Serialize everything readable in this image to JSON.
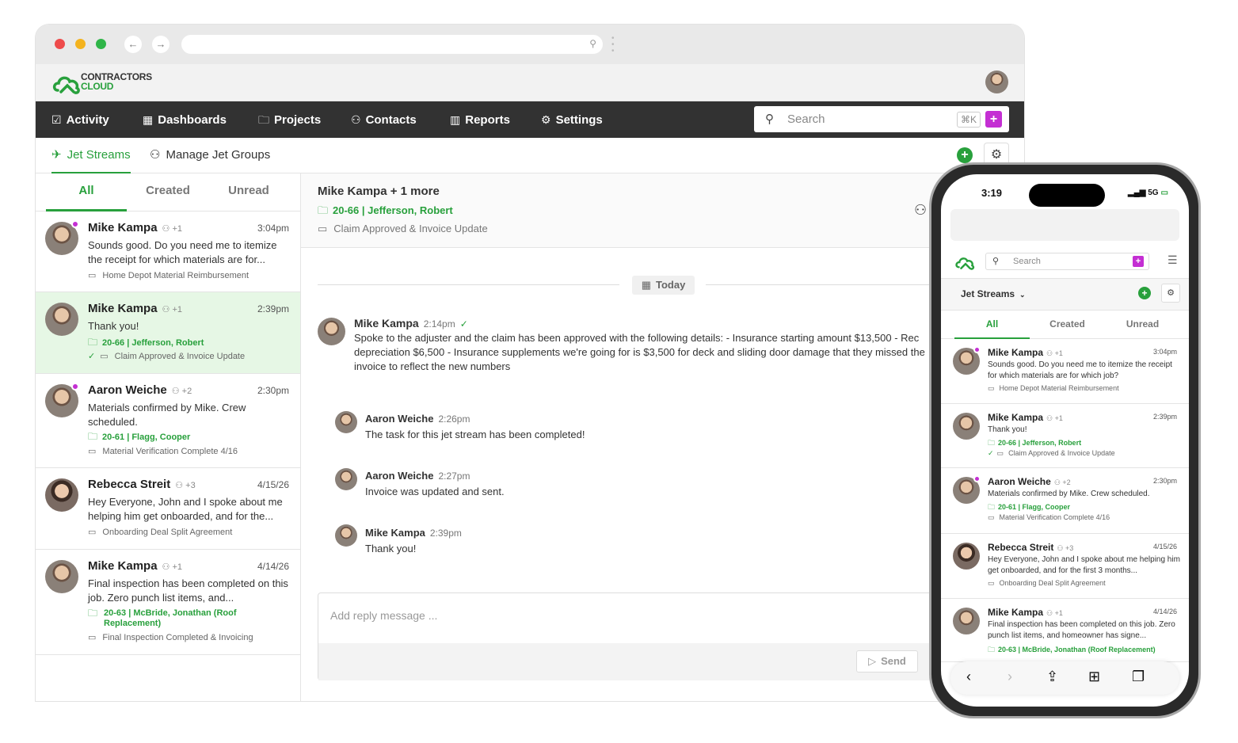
{
  "brand": {
    "name_line1": "CONTRACTORS",
    "name_line2": "CLOUD",
    "color": "#28a03c"
  },
  "colors": {
    "accent": "#28a03c",
    "magenta": "#c42fd3",
    "nav_bg": "#323232"
  },
  "nav": {
    "items": [
      {
        "icon": "check-square-icon",
        "label": "Activity"
      },
      {
        "icon": "grid-icon",
        "label": "Dashboards"
      },
      {
        "icon": "folder-icon",
        "label": "Projects"
      },
      {
        "icon": "people-icon",
        "label": "Contacts"
      },
      {
        "icon": "bar-chart-icon",
        "label": "Reports"
      },
      {
        "icon": "gear-icon",
        "label": "Settings"
      }
    ],
    "search_placeholder": "Search",
    "shortcut": "⌘K",
    "plus": "+"
  },
  "subnav": {
    "jet_streams": "Jet Streams",
    "manage_groups": "Manage Jet Groups"
  },
  "filters": {
    "all": "All",
    "created": "Created",
    "unread": "Unread"
  },
  "streams": [
    {
      "name": "Mike Kampa",
      "count": "+1",
      "time": "3:04pm",
      "message": "Sounds good. Do you need me to itemize the receipt for which materials are for...",
      "project": "",
      "subject": "Home Depot Material Reimbursement",
      "unread": true
    },
    {
      "name": "Mike Kampa",
      "count": "+1",
      "time": "2:39pm",
      "message": "Thank you!",
      "project": "20-66 | Jefferson, Robert",
      "subject": "Claim Approved & Invoice Update",
      "unread": false
    },
    {
      "name": "Aaron Weiche",
      "count": "+2",
      "time": "2:30pm",
      "message": "Materials confirmed by Mike. Crew scheduled.",
      "project": "20-61 | Flagg, Cooper",
      "subject": "Material Verification Complete 4/16",
      "unread": true
    },
    {
      "name": "Rebecca Streit",
      "count": "+3",
      "time": "4/15/26",
      "message": "Hey Everyone, John and I spoke about me helping him get onboarded, and for the...",
      "project": "",
      "subject": "Onboarding Deal Split Agreement",
      "unread": false
    },
    {
      "name": "Mike Kampa",
      "count": "+1",
      "time": "4/14/26",
      "message": "Final inspection has been completed on this job. Zero punch list items, and...",
      "project": "20-63 | McBride, Jonathan (Roof Replacement)",
      "subject": "Final Inspection Completed & Invoicing",
      "unread": false
    }
  ],
  "thread": {
    "title": "Mike Kampa + 1 more",
    "project": "20-66 | Jefferson, Robert",
    "subject": "Claim Approved & Invoice Update",
    "divider": "Today",
    "messages": [
      {
        "name": "Mike Kampa",
        "time": "2:14pm",
        "text": "Spoke to the adjuster and the claim has been approved with the following details: - Insurance starting amount $13,500 - Rec depreciation $6,500 - Insurance supplements we're going for is $3,500 for deck and sliding door damage that they missed the invoice to reflect the new numbers"
      },
      {
        "name": "Aaron Weiche",
        "time": "2:26pm",
        "text": "The task for this jet stream has been completed!"
      },
      {
        "name": "Aaron Weiche",
        "time": "2:27pm",
        "text": "Invoice was updated and sent."
      },
      {
        "name": "Mike Kampa",
        "time": "2:39pm",
        "text": "Thank you!"
      }
    ],
    "reply_placeholder": "Add reply message ...",
    "send": "Send"
  },
  "phone": {
    "time": "3:19",
    "status": "5G",
    "search_placeholder": "Search",
    "plus": "+",
    "jet_streams": "Jet Streams",
    "filters": {
      "all": "All",
      "created": "Created",
      "unread": "Unread"
    },
    "streams": [
      {
        "name": "Mike Kampa",
        "count": "+1",
        "time": "3:04pm",
        "message": "Sounds good. Do you need me to itemize the receipt for which materials are for which job?",
        "project": "",
        "subject": "Home Depot Material Reimbursement",
        "unread": true
      },
      {
        "name": "Mike Kampa",
        "count": "+1",
        "time": "2:39pm",
        "message": "Thank you!",
        "project": "20-66 | Jefferson, Robert",
        "subject": "Claim Approved & Invoice Update",
        "unread": false
      },
      {
        "name": "Aaron Weiche",
        "count": "+2",
        "time": "2:30pm",
        "message": "Materials confirmed by Mike. Crew scheduled.",
        "project": "20-61 | Flagg, Cooper",
        "subject": "Material Verification Complete 4/16",
        "unread": true
      },
      {
        "name": "Rebecca Streit",
        "count": "+3",
        "time": "4/15/26",
        "message": "Hey Everyone, John and I spoke about me helping him get onboarded, and for the first 3 months...",
        "project": "",
        "subject": "Onboarding Deal Split Agreement",
        "unread": false
      },
      {
        "name": "Mike Kampa",
        "count": "+1",
        "time": "4/14/26",
        "message": "Final inspection has been completed on this job. Zero punch list items, and homeowner has signe...",
        "project": "20-63 | McBride, Jonathan (Roof Replacement)",
        "subject": "",
        "unread": false
      }
    ]
  }
}
